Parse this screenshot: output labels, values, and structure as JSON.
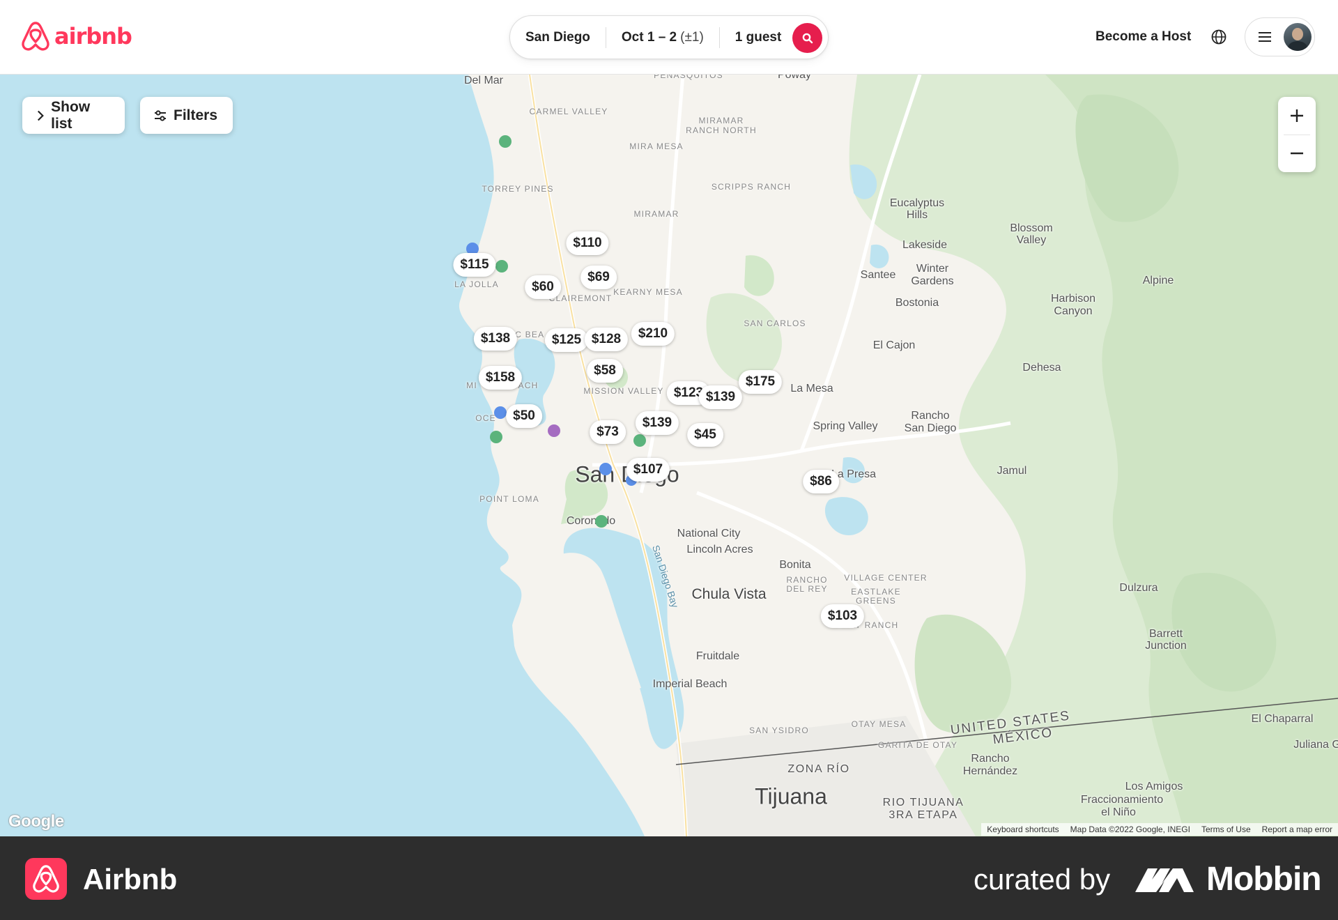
{
  "header": {
    "brand": "airbnb",
    "search": {
      "location": "San Diego",
      "dates": "Oct 1 – 2",
      "flex": "(±1)",
      "guests": "1 guest"
    },
    "become_host": "Become a Host"
  },
  "map_controls": {
    "show_list": "Show list",
    "filters": "Filters"
  },
  "price_pins": [
    {
      "id": "p110",
      "price": "$110"
    },
    {
      "id": "p115",
      "price": "$115"
    },
    {
      "id": "p69",
      "price": "$69"
    },
    {
      "id": "p60",
      "price": "$60"
    },
    {
      "id": "p210",
      "price": "$210"
    },
    {
      "id": "p138",
      "price": "$138"
    },
    {
      "id": "p125",
      "price": "$125"
    },
    {
      "id": "p128",
      "price": "$128"
    },
    {
      "id": "p58",
      "price": "$58"
    },
    {
      "id": "p158",
      "price": "$158"
    },
    {
      "id": "p175",
      "price": "$175"
    },
    {
      "id": "p123",
      "price": "$123"
    },
    {
      "id": "p139a",
      "price": "$139"
    },
    {
      "id": "p50",
      "price": "$50"
    },
    {
      "id": "p139b",
      "price": "$139"
    },
    {
      "id": "p73",
      "price": "$73"
    },
    {
      "id": "p45",
      "price": "$45"
    },
    {
      "id": "p107",
      "price": "$107"
    },
    {
      "id": "p86",
      "price": "$86"
    },
    {
      "id": "p103",
      "price": "$103"
    }
  ],
  "map_labels": [
    {
      "id": "delmar",
      "text": "Del Mar"
    },
    {
      "id": "penasquitos",
      "text": "PEÑASQUITOS"
    },
    {
      "id": "poway",
      "text": "Poway"
    },
    {
      "id": "carmelvalley",
      "text": "CARMEL VALLEY"
    },
    {
      "id": "miramarranch",
      "text": "MIRAMAR"
    },
    {
      "id": "miramarranch2",
      "text": "RANCH NORTH"
    },
    {
      "id": "miramesa",
      "text": "MIRA MESA"
    },
    {
      "id": "torreypines",
      "text": "TORREY PINES"
    },
    {
      "id": "scripps",
      "text": "SCRIPPS RANCH"
    },
    {
      "id": "miramar",
      "text": "MIRAMAR"
    },
    {
      "id": "eucalyptus",
      "text": "Eucalyptus"
    },
    {
      "id": "hills",
      "text": "Hills"
    },
    {
      "id": "blossom",
      "text": "Blossom"
    },
    {
      "id": "valley",
      "text": "Valley"
    },
    {
      "id": "lakeside",
      "text": "Lakeside"
    },
    {
      "id": "santee",
      "text": "Santee"
    },
    {
      "id": "winter",
      "text": "Winter"
    },
    {
      "id": "gardens",
      "text": "Gardens"
    },
    {
      "id": "alpine",
      "text": "Alpine"
    },
    {
      "id": "lajolla",
      "text": "LA JOLLA"
    },
    {
      "id": "clairemont",
      "text": "CLAIREMONT"
    },
    {
      "id": "kearny",
      "text": "KEARNY MESA"
    },
    {
      "id": "bostonia",
      "text": "Bostonia"
    },
    {
      "id": "harbison",
      "text": "Harbison"
    },
    {
      "id": "canyon",
      "text": "Canyon"
    },
    {
      "id": "sancarlos",
      "text": "SAN CARLOS"
    },
    {
      "id": "elcajon",
      "text": "El Cajon"
    },
    {
      "id": "dehesa",
      "text": "Dehesa"
    },
    {
      "id": "missionvalley",
      "text": "MISSION VALLEY"
    },
    {
      "id": "lamesa",
      "text": "La Mesa"
    },
    {
      "id": "rancho",
      "text": "Rancho"
    },
    {
      "id": "sandiego2",
      "text": "San Diego"
    },
    {
      "id": "springvalley",
      "text": "Spring Valley"
    },
    {
      "id": "jamul",
      "text": "Jamul"
    },
    {
      "id": "lapresa",
      "text": "La Presa"
    },
    {
      "id": "sandiego",
      "text": "San Diego"
    },
    {
      "id": "pointloma",
      "text": "POINT LOMA"
    },
    {
      "id": "coronado",
      "text": "Coronado"
    },
    {
      "id": "nationalcity",
      "text": "National City"
    },
    {
      "id": "lincolnacres",
      "text": "Lincoln Acres"
    },
    {
      "id": "bonita",
      "text": "Bonita"
    },
    {
      "id": "ranchodelrey",
      "text": "RANCHO"
    },
    {
      "id": "ranchodelrey2",
      "text": "DEL REY"
    },
    {
      "id": "villagecenter",
      "text": "VILLAGE CENTER"
    },
    {
      "id": "eastlake",
      "text": "EASTLAKE"
    },
    {
      "id": "greens",
      "text": "GREENS"
    },
    {
      "id": "chulavista",
      "text": "Chula Vista"
    },
    {
      "id": "otayranch",
      "text": "OTAY RANCH"
    },
    {
      "id": "dulzura",
      "text": "Dulzura"
    },
    {
      "id": "fruitdale",
      "text": "Fruitdale"
    },
    {
      "id": "barrett",
      "text": "Barrett"
    },
    {
      "id": "junction",
      "text": "Junction"
    },
    {
      "id": "imperialbeach",
      "text": "Imperial Beach"
    },
    {
      "id": "sanysidro",
      "text": "SAN YSIDRO"
    },
    {
      "id": "otaymesa",
      "text": "OTAY MESA"
    },
    {
      "id": "unitedstates",
      "text": "UNITED STATES"
    },
    {
      "id": "mexico",
      "text": "MÉXICO"
    },
    {
      "id": "elchaparral",
      "text": "El Chaparral"
    },
    {
      "id": "julianag",
      "text": "Juliana G"
    },
    {
      "id": "garita",
      "text": "GARITA DE OTAY"
    },
    {
      "id": "ranchohern",
      "text": "Rancho"
    },
    {
      "id": "ranchohern2",
      "text": "Hernández"
    },
    {
      "id": "zonario",
      "text": "ZONA RÍO"
    },
    {
      "id": "tijuana",
      "text": "Tijuana"
    },
    {
      "id": "riotijuana",
      "text": "RIO TIJUANA"
    },
    {
      "id": "etapa",
      "text": "3RA ETAPA"
    },
    {
      "id": "losamigos",
      "text": "Los Amigos"
    },
    {
      "id": "fracc",
      "text": "Fraccionamiento"
    },
    {
      "id": "elnino",
      "text": "el Niño"
    },
    {
      "id": "sandiegobay",
      "text": "San Diego Bay"
    },
    {
      "id": "missionbeach",
      "text": "MI"
    },
    {
      "id": "ach",
      "text": "ACH"
    },
    {
      "id": "ocean",
      "text": "OCE"
    },
    {
      "id": "icbea",
      "text": "IC BEA"
    }
  ],
  "attribution": {
    "google": "Google",
    "keyboard": "Keyboard shortcuts",
    "map_data": "Map Data ©2022 Google, INEGI",
    "terms": "Terms of Use",
    "report": "Report a map error"
  },
  "footer": {
    "app_name": "Airbnb",
    "curated_by": "curated by",
    "curator": "Mobbin"
  },
  "colors": {
    "brand": "#ff385c",
    "search_button": "#e61e4d",
    "water": "#bde3f0",
    "land": "#f5f3ee",
    "park": "#dcebd3",
    "footer_bg": "#2d2d2d"
  }
}
